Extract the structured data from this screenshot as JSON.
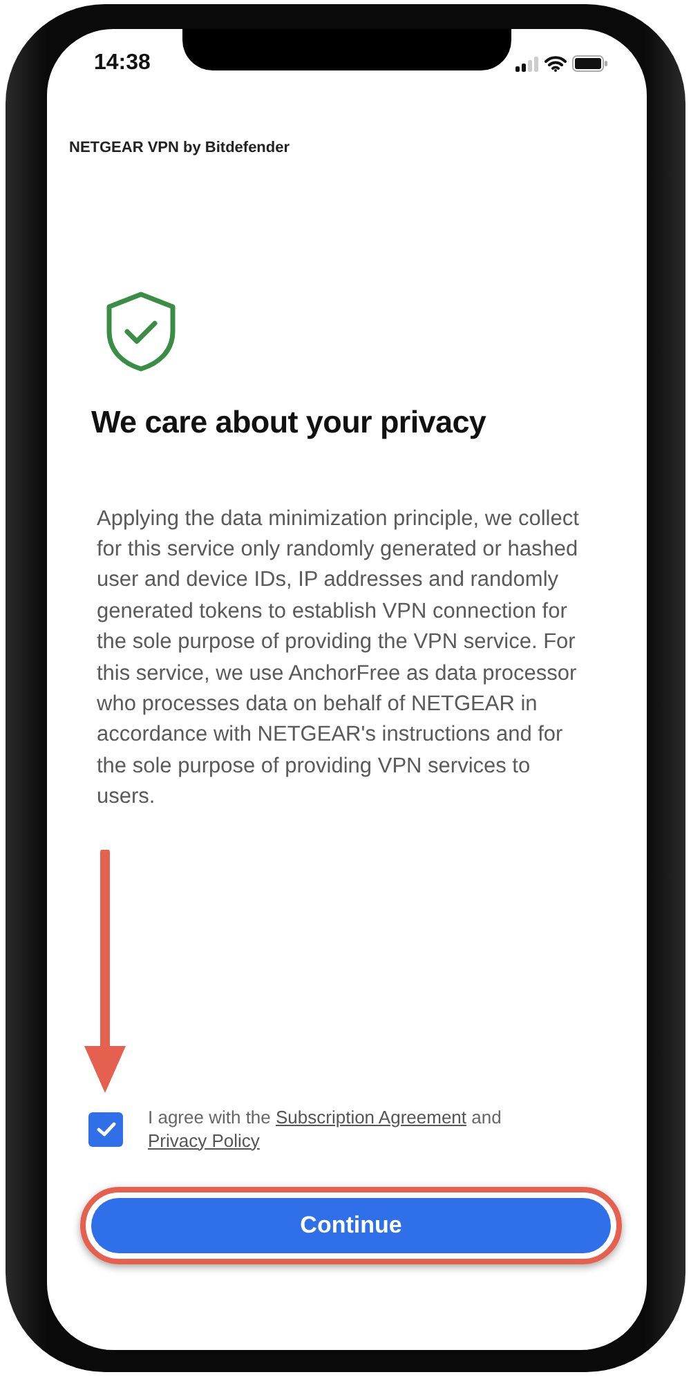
{
  "status_bar": {
    "time": "14:38"
  },
  "app_header": {
    "title": "NETGEAR VPN by Bitdefender"
  },
  "heading": "We care about your privacy",
  "body": "Applying the data minimization principle, we collect for this service only randomly generated or hashed user and device IDs, IP addresses and randomly generated tokens to establish VPN connection for the sole purpose of providing the VPN service. For this service, we use AnchorFree as data processor who processes data on behalf of NETGEAR in accordance with NETGEAR's instructions and for the sole purpose of providing VPN services to users.",
  "agreement": {
    "checked": true,
    "text_before": "I agree with the",
    "link_1": "Subscription Agreement",
    "text_middle": "and",
    "link_2": "Privacy Policy"
  },
  "button": {
    "label": "Continue"
  }
}
